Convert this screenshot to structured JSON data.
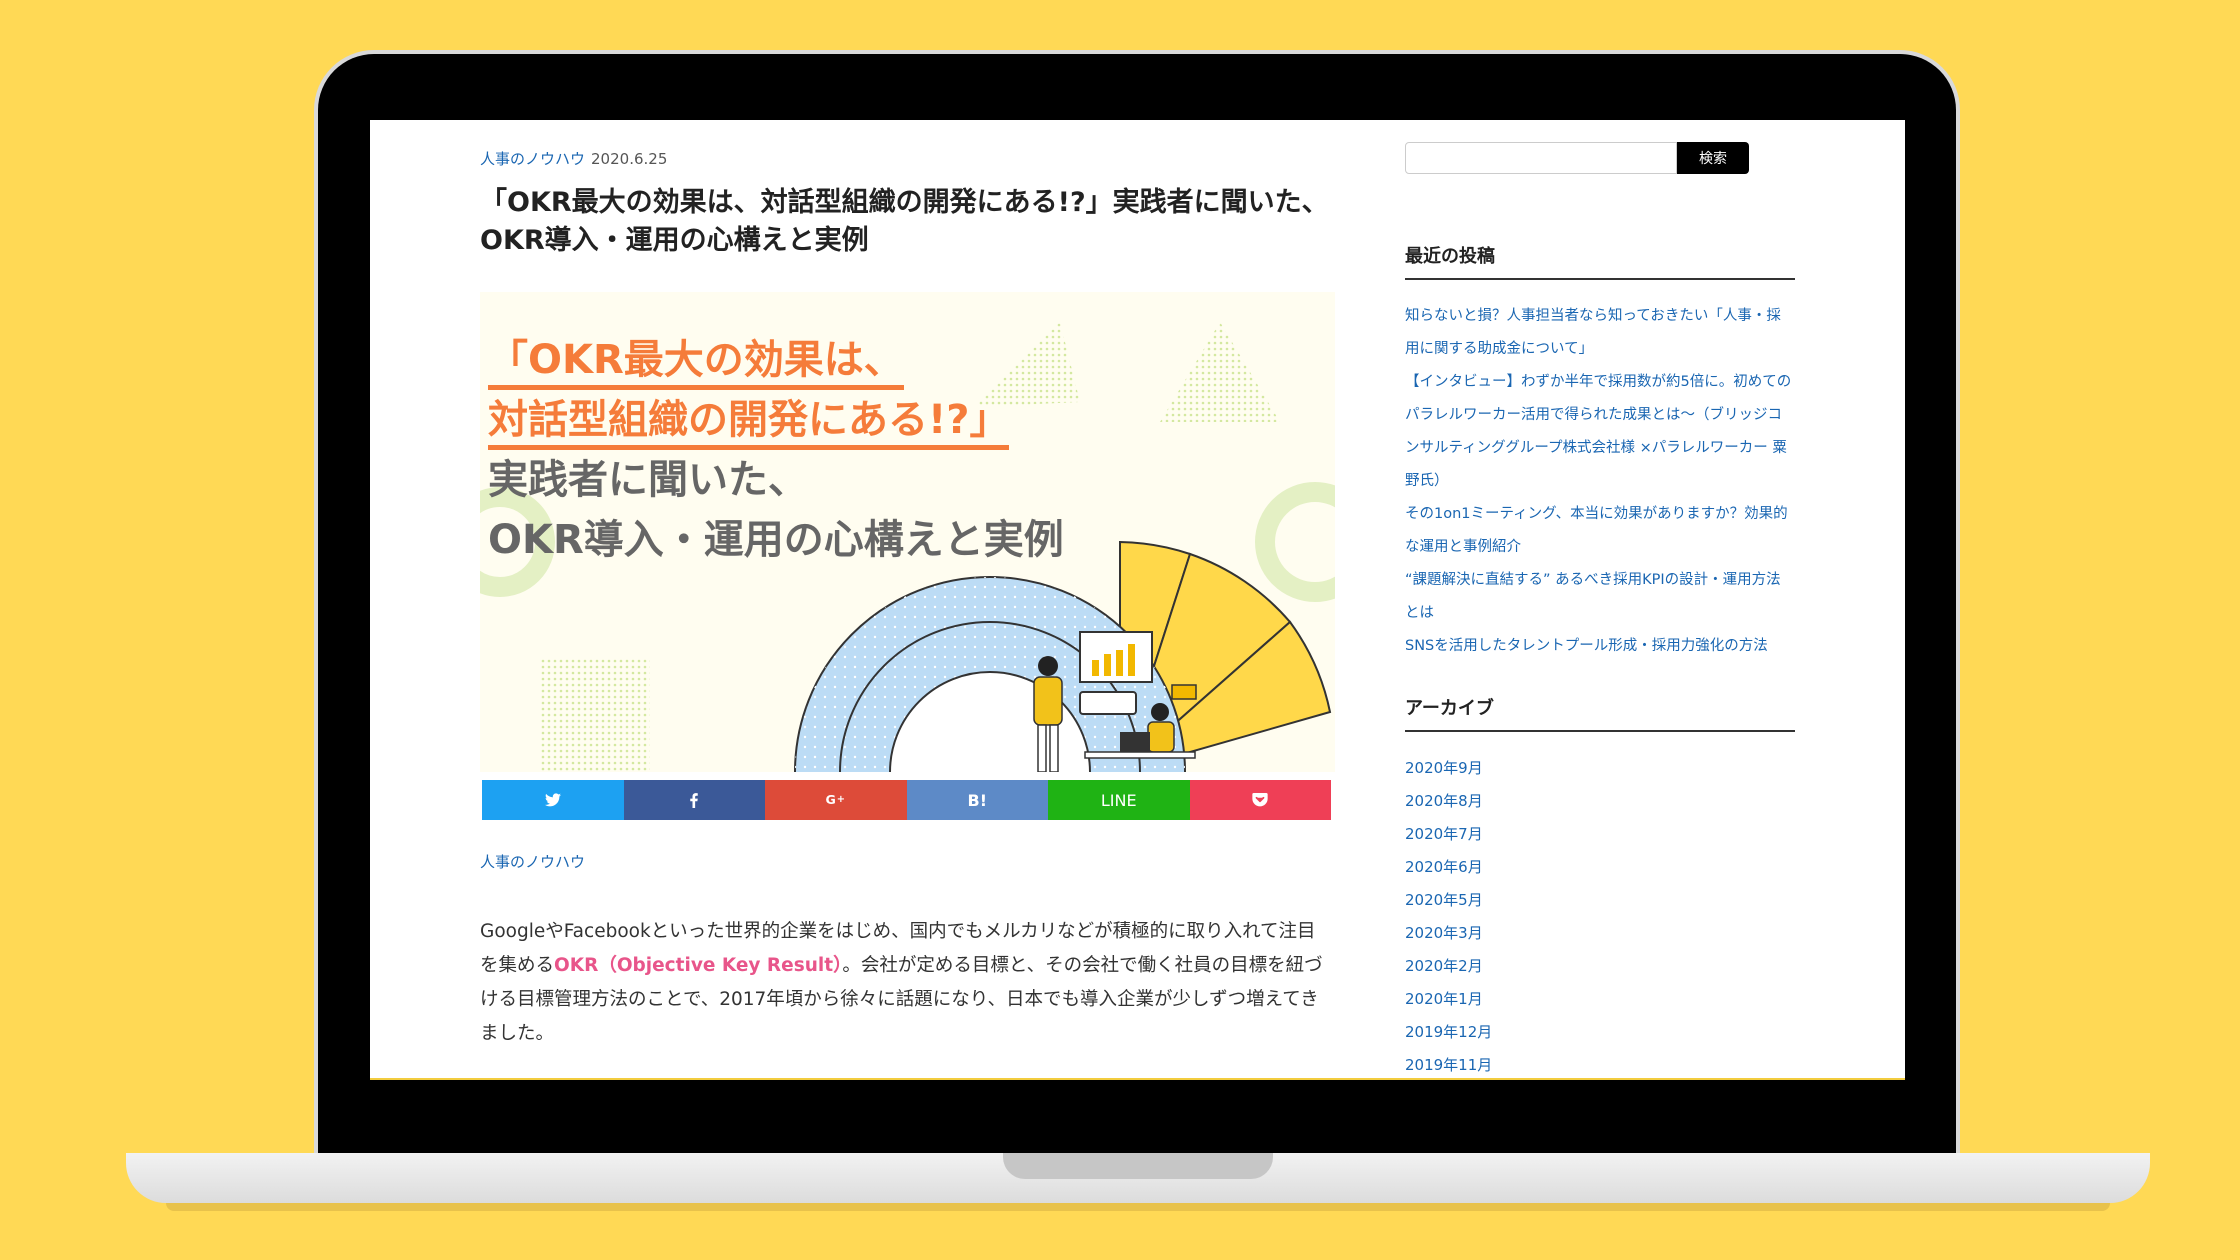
{
  "post": {
    "category": "人事のノウハウ",
    "date": "2020.6.25",
    "title": "「OKR最大の効果は、対話型組織の開発にある!?」実践者に聞いた、OKR導入・運用の心構えと実例",
    "hero": {
      "line1": "「OKR最大の効果は、",
      "line2": "対話型組織の開発にある!?」",
      "line3": "実践者に聞いた、",
      "line4": "OKR導入・運用の心構えと実例"
    },
    "share": {
      "hatena_label": "B!",
      "line_label": "LINE"
    },
    "category_link": "人事のノウハウ",
    "body": {
      "p1_before": "GoogleやFacebookといった世界的企業をはじめ、国内でもメルカリなどが積極的に取り入れて注目を集める",
      "okr_link": "OKR（Objective Key Result）",
      "p1_after": "。会社が定める目標と、その会社で働く社員の目標を紐づける目標管理方法のことで、2017年頃から徐々に話題になり、日本でも導入企業が少しずつ増えてきました。"
    }
  },
  "sidebar": {
    "search": {
      "value": "",
      "button": "検索"
    },
    "recent_title": "最近の投稿",
    "recent_posts": [
      "知らないと損？人事担当者なら知っておきたい「人事・採用に関する助成金について」",
      "【インタビュー】わずか半年で採用数が約5倍に。初めてのパラレルワーカー活用で得られた成果とは〜（ブリッジコンサルティンググループ株式会社様 ×パラレルワーカー 粟野氏）",
      "その1on1ミーティング、本当に効果がありますか？効果的な運用と事例紹介",
      "“課題解決に直結する” あるべき採用KPIの設計・運用方法とは",
      "SNSを活用したタレントプール形成・採用力強化の方法"
    ],
    "archive_title": "アーカイブ",
    "archives": [
      "2020年9月",
      "2020年8月",
      "2020年7月",
      "2020年6月",
      "2020年5月",
      "2020年3月",
      "2020年2月",
      "2020年1月",
      "2019年12月",
      "2019年11月"
    ]
  },
  "colors": {
    "background": "#ffd955",
    "link": "#1a66b2",
    "accent_orange": "#f57c3a",
    "okr_pink": "#e8558a",
    "twitter": "#1da1f2",
    "facebook": "#3b5998",
    "google": "#dd4b39",
    "hatena": "#5d8ac7",
    "line": "#1fb314",
    "pocket": "#ef3f56"
  }
}
